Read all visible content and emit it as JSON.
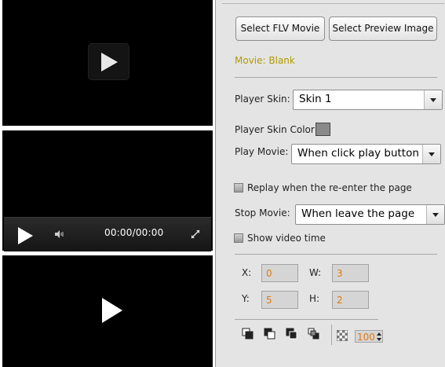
{
  "previews": {
    "pane2": {
      "time": "00:00/00:00"
    }
  },
  "buttons": {
    "select_flv": "Select FLV Movie",
    "select_preview": "Select Preview Image"
  },
  "movie": {
    "label": "Movie: Blank"
  },
  "player_skin": {
    "label": "Player Skin:",
    "value": "Skin 1"
  },
  "skin_color": {
    "label": "Player Skin Color:",
    "color": "#8a8a8a"
  },
  "play_movie": {
    "label": "Play Movie:",
    "value": "When click play button"
  },
  "replay": {
    "label": "Replay when the re-enter the page",
    "checked": false
  },
  "stop_movie": {
    "label": "Stop Movie:",
    "value": "When leave the page"
  },
  "show_time": {
    "label": "Show video time",
    "checked": false
  },
  "position": {
    "x_label": "X:",
    "x": "0",
    "w_label": "W:",
    "w": "3",
    "y_label": "Y:",
    "y": "5",
    "h_label": "H:",
    "h": "2"
  },
  "toolbar": {
    "tools": [
      "bring-to-front-icon",
      "send-to-back-icon",
      "bring-forward-icon",
      "send-backward-icon"
    ],
    "opacity_icon": "opacity-icon",
    "opacity": "100"
  },
  "colors": {
    "accent_text": "#b09a00",
    "field_text": "#e07a10"
  }
}
